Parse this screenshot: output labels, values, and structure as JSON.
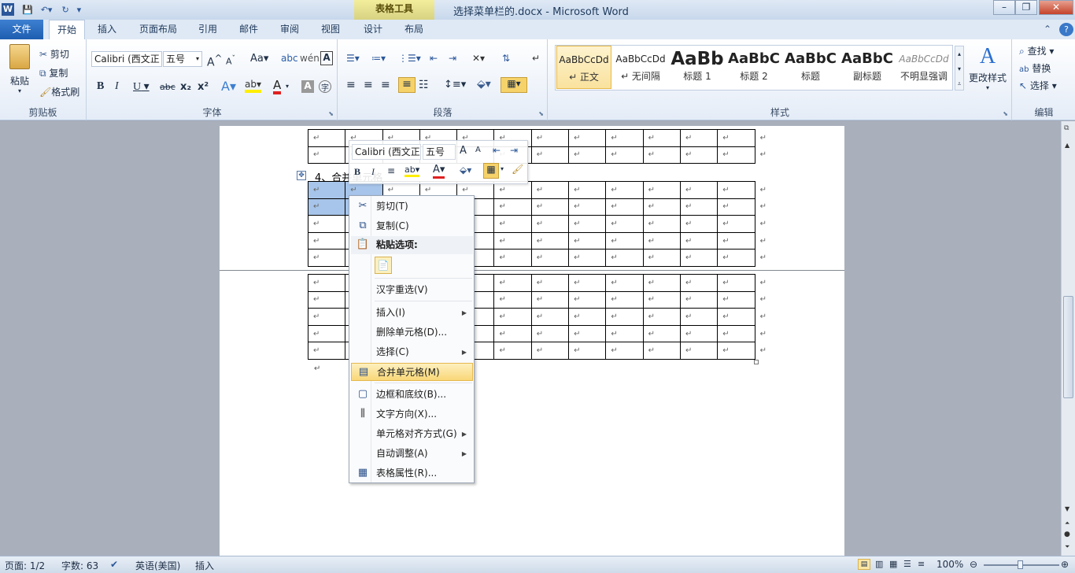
{
  "window": {
    "title": "选择菜单栏的.docx - Microsoft Word",
    "context_tab_group": "表格工具",
    "app_icon": "W"
  },
  "tabs": [
    "文件",
    "开始",
    "插入",
    "页面布局",
    "引用",
    "邮件",
    "审阅",
    "视图",
    "设计",
    "布局"
  ],
  "ribbon": {
    "clipboard": {
      "paste": "粘贴",
      "cut": "剪切",
      "copy": "复制",
      "format_painter": "格式刷",
      "label": "剪贴板"
    },
    "font": {
      "name": "Calibri (西文正",
      "size": "五号",
      "label": "字体",
      "bold": "B",
      "italic": "I",
      "underline": "U",
      "strike": "abc",
      "sub": "x₂",
      "sup": "x²",
      "aa": "Aa"
    },
    "paragraph": {
      "label": "段落"
    },
    "styles": {
      "label": "样式",
      "items": [
        {
          "sample": "AaBbCcDd",
          "name": "↵ 正文"
        },
        {
          "sample": "AaBbCcDd",
          "name": "↵ 无间隔"
        },
        {
          "sample": "AaBb",
          "name": "标题 1"
        },
        {
          "sample": "AaBbC",
          "name": "标题 2"
        },
        {
          "sample": "AaBbC",
          "name": "标题"
        },
        {
          "sample": "AaBbC",
          "name": "副标题"
        },
        {
          "sample": "AaBbCcDd",
          "name": "不明显强调"
        }
      ],
      "change_styles": "更改样式"
    },
    "editing": {
      "find": "查找",
      "replace": "替换",
      "select": "选择",
      "label": "编辑"
    }
  },
  "document": {
    "heading": "4、合并单元格"
  },
  "mini_toolbar": {
    "font": "Calibri (西文正",
    "size": "五号"
  },
  "context_menu": {
    "items": [
      {
        "label": "剪切(T)",
        "icon": "scissors-icon"
      },
      {
        "label": "复制(C)",
        "icon": "copy-icon"
      },
      {
        "label": "粘贴选项:",
        "icon": "paste-icon"
      },
      {
        "label": "汉字重选(V)",
        "icon": ""
      },
      {
        "label": "插入(I)",
        "icon": "",
        "submenu": true
      },
      {
        "label": "删除单元格(D)...",
        "icon": ""
      },
      {
        "label": "选择(C)",
        "icon": "",
        "submenu": true
      },
      {
        "label": "合并单元格(M)",
        "icon": "merge-cells-icon",
        "highlighted": true
      },
      {
        "label": "边框和底纹(B)...",
        "icon": "border-icon"
      },
      {
        "label": "文字方向(X)...",
        "icon": "text-direction-icon"
      },
      {
        "label": "单元格对齐方式(G)",
        "icon": "",
        "submenu": true
      },
      {
        "label": "自动调整(A)",
        "icon": "",
        "submenu": true
      },
      {
        "label": "表格属性(R)...",
        "icon": "table-properties-icon"
      }
    ]
  },
  "status": {
    "page": "页面: 1/2",
    "words": "字数: 63",
    "language": "英语(美国)",
    "mode": "插入",
    "zoom": "100%"
  }
}
